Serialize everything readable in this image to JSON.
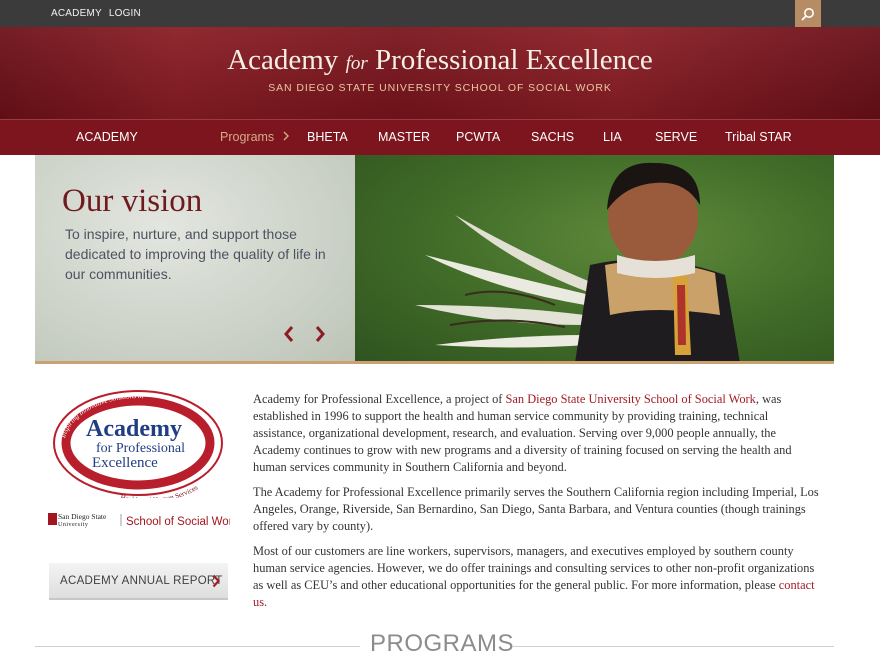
{
  "topbar": {
    "links": [
      "ACADEMY",
      "LOGIN"
    ],
    "search_icon": "search-icon"
  },
  "banner": {
    "title_part1": "Academy ",
    "title_italic": "for",
    "title_part2": " Professional Excellence",
    "subtitle": "SAN DIEGO STATE UNIVERSITY SCHOOL OF SOCIAL WORK"
  },
  "nav": {
    "home": "ACADEMY",
    "programs_label": "Programs",
    "items": [
      "BHETA",
      "MASTER",
      "PCWTA",
      "SACHS",
      "LIA",
      "SERVE",
      "Tribal STAR"
    ]
  },
  "hero": {
    "title": "Our vision",
    "text": "To inspire, nurture, and support those dedicated to improving the quality of life in our communities.",
    "prev_icon": "chevron-left-icon",
    "next_icon": "chevron-right-icon"
  },
  "logo": {
    "ring_text_top": "Inspiring Innovative Solutions in",
    "ring_text_bottom": "Health and Human Services",
    "line1": "Academy",
    "line2": "for Professional",
    "line3": "Excellence"
  },
  "sdsu": {
    "name_top": "San Diego State",
    "name_bottom": "University",
    "school": "School of Social Work"
  },
  "report_button": {
    "label": "ACADEMY ANNUAL REPORT"
  },
  "content": {
    "p1_pre": "Academy for Professional Excellence, a project of ",
    "p1_link": "San Diego State University School of Social Work",
    "p1_post": ", was established in 1996 to support the health and human service community by providing training, technical assistance, organizational development, research, and evaluation. Serving over 9,000 people annually, the Academy continues to grow with new programs and a diversity of training focused on serving the health and human services community in Southern California and beyond.",
    "p2": "The Academy for Professional Excellence primarily serves the Southern California region including Imperial, Los Angeles, Orange, Riverside, San Bernardino, San Diego, Santa Barbara, and Ventura counties (though trainings offered vary by county).",
    "p3_pre": "Most of our customers are line workers, supervisors, managers, and executives employed by southern county human service agencies. However, we do offer trainings and consulting services to other non-profit organizations as well as CEU’s and other educational opportunities for the general public.  For more information, please ",
    "p3_link": "contact us",
    "p3_post": "."
  },
  "programs_heading": "PROGRAMS",
  "colors": {
    "brand_maroon": "#7c151e",
    "accent_gold": "#b58c63",
    "link_red": "#a31b25"
  }
}
